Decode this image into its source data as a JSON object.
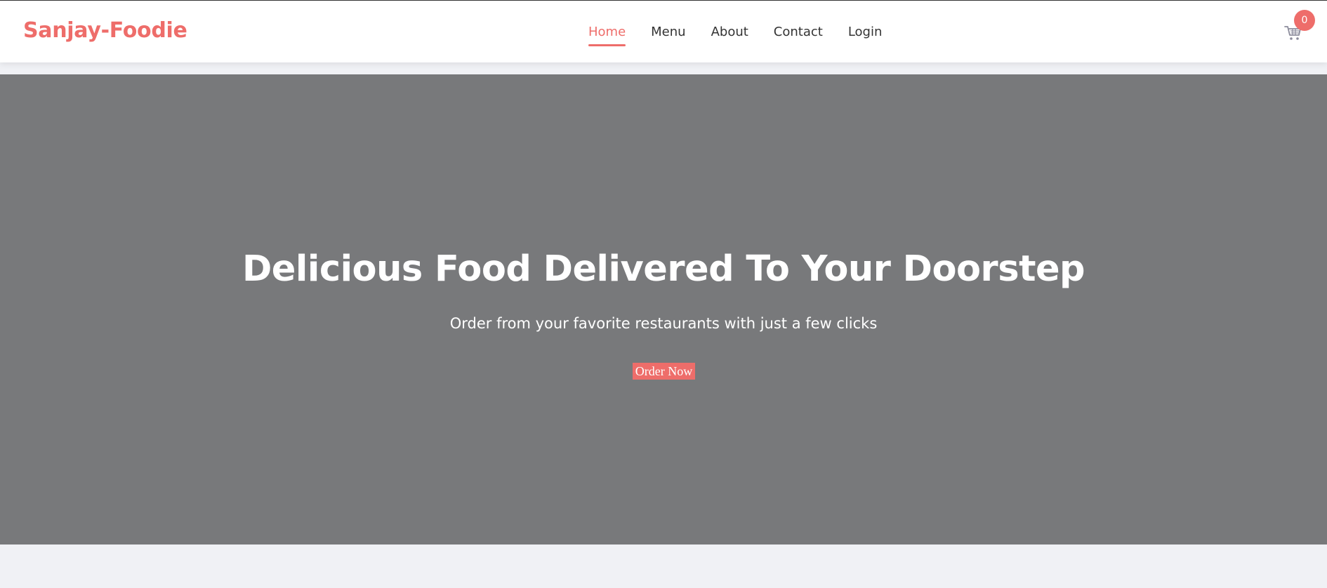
{
  "navbar": {
    "brand": "Sanjay-Foodie",
    "links": [
      {
        "label": "Home",
        "active": true
      },
      {
        "label": "Menu",
        "active": false
      },
      {
        "label": "About",
        "active": false
      },
      {
        "label": "Contact",
        "active": false
      },
      {
        "label": "Login",
        "active": false
      }
    ],
    "cart": {
      "icon": "cart-icon",
      "count": "0"
    }
  },
  "hero": {
    "title": "Delicious Food Delivered To Your Doorstep",
    "subtitle": "Order from your favorite restaurants with just a few clicks",
    "cta_label": "Order Now"
  },
  "colors": {
    "accent": "#ee6d6a",
    "hero_background": "#78797b",
    "page_background": "#f0f1f5",
    "nav_text": "#333333"
  }
}
